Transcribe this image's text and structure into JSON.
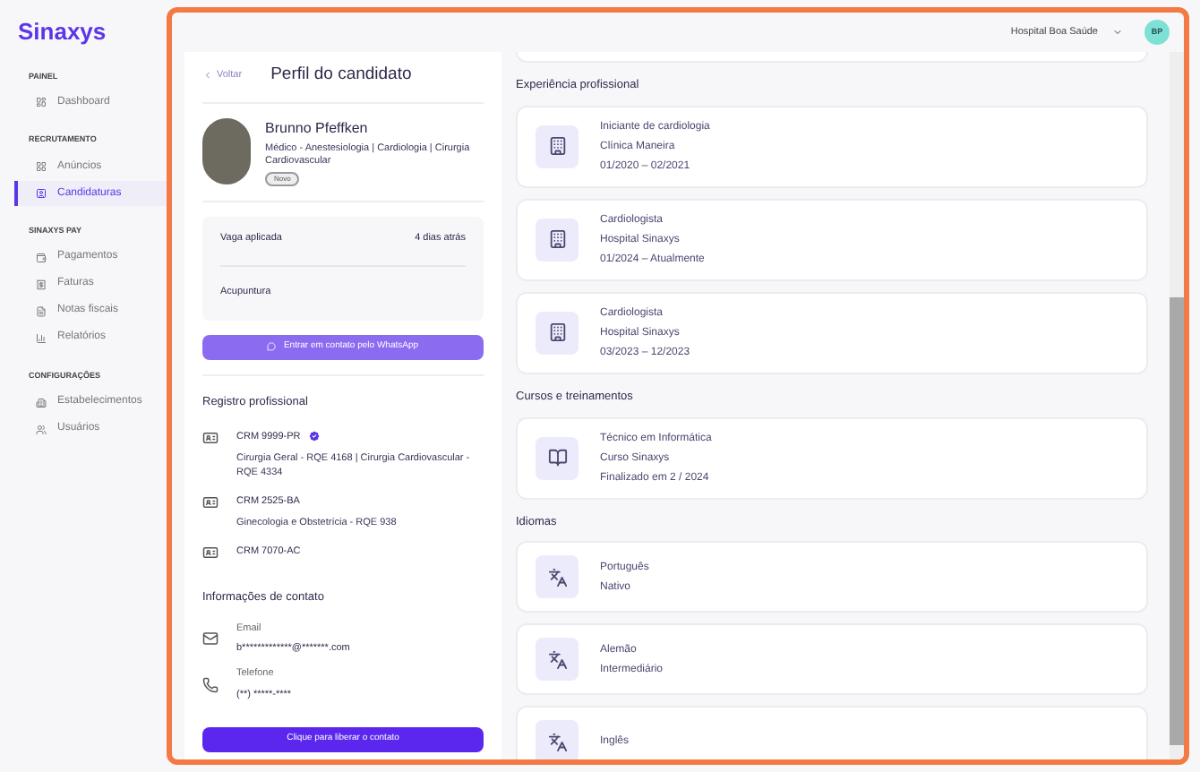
{
  "sidebar": {
    "logo": "Sinaxys",
    "sections": [
      {
        "title": "PAINEL",
        "items": [
          {
            "label": "Dashboard",
            "selected": false
          }
        ]
      },
      {
        "title": "RECRUTAMENTO",
        "items": [
          {
            "label": "Anúncios",
            "selected": false
          },
          {
            "label": "Candidaturas",
            "selected": true
          }
        ]
      },
      {
        "title": "SINAXYS PAY",
        "items": [
          {
            "label": "Pagamentos",
            "selected": false
          },
          {
            "label": "Faturas",
            "selected": false
          },
          {
            "label": "Notas fiscais",
            "selected": false
          },
          {
            "label": "Relatórios",
            "selected": false
          }
        ]
      },
      {
        "title": "CONFIGURAÇÕES",
        "items": [
          {
            "label": "Estabelecimentos",
            "selected": false
          },
          {
            "label": "Usuários",
            "selected": false
          }
        ]
      }
    ]
  },
  "topbar": {
    "organization": "Hospital Boa Saúde",
    "avatar": "BP"
  },
  "profile": {
    "back": "Voltar",
    "title": "Perfil do candidato",
    "name": "Brunno Pfeffken",
    "specialty": "Médico - Anestesiologia | Cardiologia | Cirurgia Cardiovascular",
    "badge": "Novo"
  },
  "application": {
    "label": "Vaga aplicada",
    "time": "4 dias atrás",
    "job": "Acupuntura"
  },
  "whatsapp_button": "Entrar em contato pelo WhatsApp",
  "registry": {
    "title": "Registro profissional",
    "items": [
      {
        "crm": "CRM 9999-PR",
        "verified": true,
        "details": "Cirurgia Geral - RQE 4168 | Cirurgia Cardiovascular - RQE 4334"
      },
      {
        "crm": "CRM 2525-BA",
        "verified": false,
        "details": "Ginecologia e Obstetrícia - RQE 938"
      },
      {
        "crm": "CRM 7070-AC",
        "verified": false
      }
    ]
  },
  "contact": {
    "title": "Informações de contato",
    "items": [
      {
        "kind": "email",
        "label": "Email",
        "value": "b*************@*******.com"
      },
      {
        "kind": "phone",
        "label": "Telefone",
        "value": "(**) *****-****"
      }
    ]
  },
  "release_button": "Clique para liberar o contato",
  "experience": {
    "title": "Experiência profissional",
    "items": [
      {
        "role": "Iniciante de cardiologia",
        "place": "Clínica Maneira",
        "period": "01/2020 – 02/2021"
      },
      {
        "role": "Cardiologista",
        "place": "Hospital Sinaxys",
        "period": "01/2024 – Atualmente"
      },
      {
        "role": "Cardiologista",
        "place": "Hospital Sinaxys",
        "period": "03/2023 – 12/2023"
      }
    ]
  },
  "courses": {
    "title": "Cursos e treinamentos",
    "items": [
      {
        "name": "Técnico em Informática",
        "place": "Curso Sinaxys",
        "finished": "Finalizado em 2 / 2024"
      }
    ]
  },
  "languages": {
    "title": "Idiomas",
    "items": [
      {
        "name": "Português",
        "level": "Nativo"
      },
      {
        "name": "Alemão",
        "level": "Intermediário"
      },
      {
        "name": "Inglês"
      }
    ]
  }
}
